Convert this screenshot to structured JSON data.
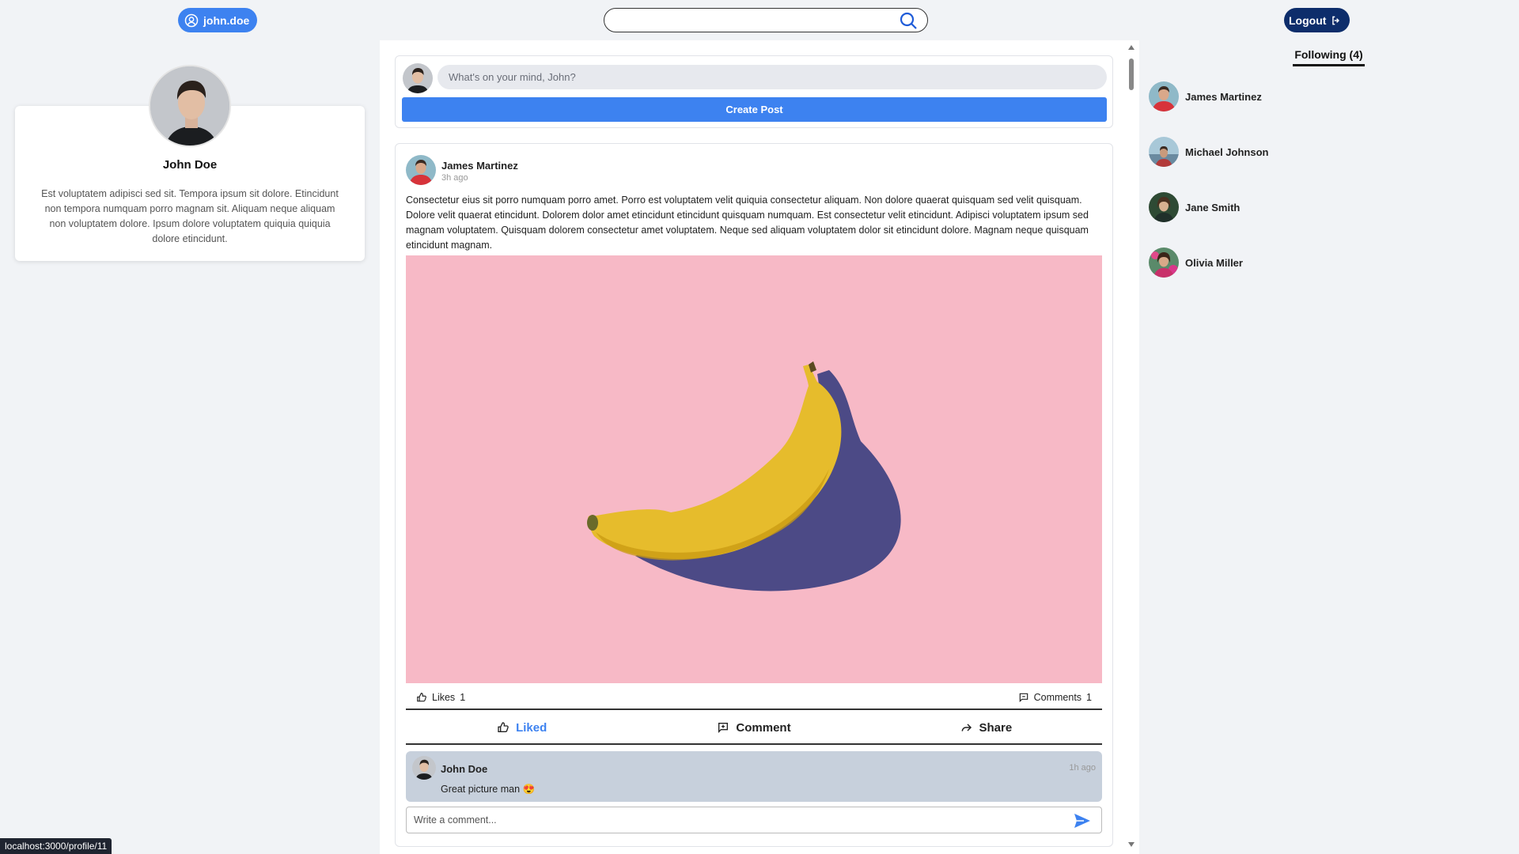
{
  "header": {
    "username": "john.doe",
    "search_placeholder": "",
    "logout_label": "Logout"
  },
  "profile": {
    "name": "John Doe",
    "bio": "Est voluptatem adipisci sed sit. Tempora ipsum sit dolore. Etincidunt non tempora numquam porro magnam sit. Aliquam neque aliquam non voluptatem dolore. Ipsum dolore voluptatem quiquia quiquia dolore etincidunt."
  },
  "composer": {
    "placeholder": "What's on your mind, John?",
    "create_label": "Create Post"
  },
  "post": {
    "author": "James Martinez",
    "time": "3h ago",
    "text": "Consectetur eius sit porro numquam porro amet. Porro est voluptatem velit quiquia consectetur aliquam. Non dolore quaerat quisquam sed velit quisquam. Dolore velit quaerat etincidunt. Dolorem dolor amet etincidunt etincidunt quisquam numquam. Est consectetur velit etincidunt. Adipisci voluptatem ipsum sed magnam voluptatem. Quisquam dolorem consectetur amet voluptatem. Neque sed aliquam voluptatem dolor sit etincidunt dolore. Magnam neque quisquam etincidunt magnam.",
    "image_icon": "banana-photo",
    "likes_label": "Likes",
    "likes_count": "1",
    "comments_label": "Comments",
    "comments_count": "1",
    "actions": {
      "like": "Liked",
      "comment": "Comment",
      "share": "Share"
    },
    "comment": {
      "author": "John Doe",
      "time": "1h ago",
      "text": "Great picture man 😍"
    },
    "write_comment_placeholder": "Write a comment..."
  },
  "following": {
    "tab_label": "Following (4)",
    "items": [
      {
        "name": "James Martinez"
      },
      {
        "name": "Michael Johnson"
      },
      {
        "name": "Jane Smith"
      },
      {
        "name": "Olivia Miller"
      }
    ]
  },
  "status_url": "localhost:3000/profile/11",
  "colors": {
    "accent": "#3d82f0",
    "logout": "#0d2d6b",
    "image_bg": "#f7b9c6",
    "comment_bg": "#c7d0dc"
  }
}
